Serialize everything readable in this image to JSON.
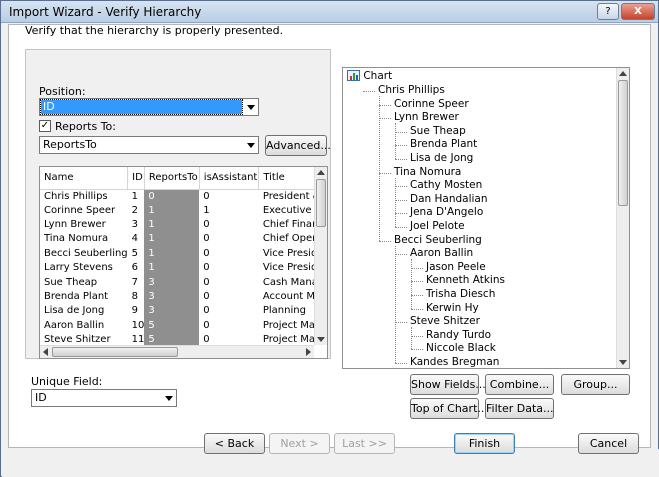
{
  "window": {
    "title": "Import Wizard - Verify Hierarchy",
    "help_label": "?",
    "close_label": "X"
  },
  "instruction": "Verify that the hierarchy is properly presented.",
  "position": {
    "label": "Position:",
    "value": "ID"
  },
  "reports_to": {
    "label": "Reports To:",
    "checked": true,
    "check_mark": "✓",
    "value": "ReportsTo",
    "advanced_label": "Advanced..."
  },
  "table": {
    "columns": [
      "Name",
      "ID",
      "ReportsTo",
      "isAssistant",
      "Title"
    ],
    "rows": [
      {
        "name": "Chris Phillips",
        "id": "1",
        "reports_to": "0",
        "is_assistant": "0",
        "title": "President & CEO"
      },
      {
        "name": "Corinne Speer",
        "id": "2",
        "reports_to": "1",
        "is_assistant": "1",
        "title": "Executive Secretary"
      },
      {
        "name": "Lynn Brewer",
        "id": "3",
        "reports_to": "1",
        "is_assistant": "0",
        "title": "Chief Financial Officer"
      },
      {
        "name": "Tina Nomura",
        "id": "4",
        "reports_to": "1",
        "is_assistant": "0",
        "title": "Chief Operations Officer"
      },
      {
        "name": "Becci Seuberling",
        "id": "5",
        "reports_to": "1",
        "is_assistant": "0",
        "title": "Vice President"
      },
      {
        "name": "Larry Stevens",
        "id": "6",
        "reports_to": "1",
        "is_assistant": "0",
        "title": "Vice President"
      },
      {
        "name": "Sue Theap",
        "id": "7",
        "reports_to": "3",
        "is_assistant": "0",
        "title": "Cash Manager"
      },
      {
        "name": "Brenda Plant",
        "id": "8",
        "reports_to": "3",
        "is_assistant": "0",
        "title": "Account Manager"
      },
      {
        "name": "Lisa de Jong",
        "id": "9",
        "reports_to": "3",
        "is_assistant": "0",
        "title": "Planning"
      },
      {
        "name": "Aaron Ballin",
        "id": "10",
        "reports_to": "5",
        "is_assistant": "0",
        "title": "Project Manager"
      },
      {
        "name": "Steve Shitzer",
        "id": "11",
        "reports_to": "5",
        "is_assistant": "0",
        "title": "Project Manager"
      }
    ]
  },
  "unique_field": {
    "label": "Unique Field:",
    "value": "ID"
  },
  "tree": {
    "root": "Chart",
    "nodes": [
      {
        "label": "Chris Phillips",
        "level": 1
      },
      {
        "label": "Corinne Speer",
        "level": 2
      },
      {
        "label": "Lynn Brewer",
        "level": 2
      },
      {
        "label": "Sue Theap",
        "level": 3
      },
      {
        "label": "Brenda Plant",
        "level": 3
      },
      {
        "label": "Lisa de Jong",
        "level": 3
      },
      {
        "label": "Tina Nomura",
        "level": 2
      },
      {
        "label": "Cathy Mosten",
        "level": 3
      },
      {
        "label": "Dan Handalian",
        "level": 3
      },
      {
        "label": "Jena D'Angelo",
        "level": 3
      },
      {
        "label": "Joel Pelote",
        "level": 3
      },
      {
        "label": "Becci Seuberling",
        "level": 2
      },
      {
        "label": "Aaron Ballin",
        "level": 3
      },
      {
        "label": "Jason Peele",
        "level": 4
      },
      {
        "label": "Kenneth Atkins",
        "level": 4
      },
      {
        "label": "Trisha Diesch",
        "level": 4
      },
      {
        "label": "Kerwin Hy",
        "level": 4
      },
      {
        "label": "Steve Shitzer",
        "level": 3
      },
      {
        "label": "Randy Turdo",
        "level": 4
      },
      {
        "label": "Niccole Black",
        "level": 4
      },
      {
        "label": "Kandes Bregman",
        "level": 3
      }
    ]
  },
  "tree_buttons": {
    "show_fields": "Show Fields...",
    "combine": "Combine...",
    "group": "Group...",
    "top_of_chart": "Top of Chart...",
    "filter_data": "Filter Data..."
  },
  "nav": {
    "back": "< Back",
    "next": "Next >",
    "last": "Last >>",
    "finish": "Finish",
    "cancel": "Cancel"
  }
}
